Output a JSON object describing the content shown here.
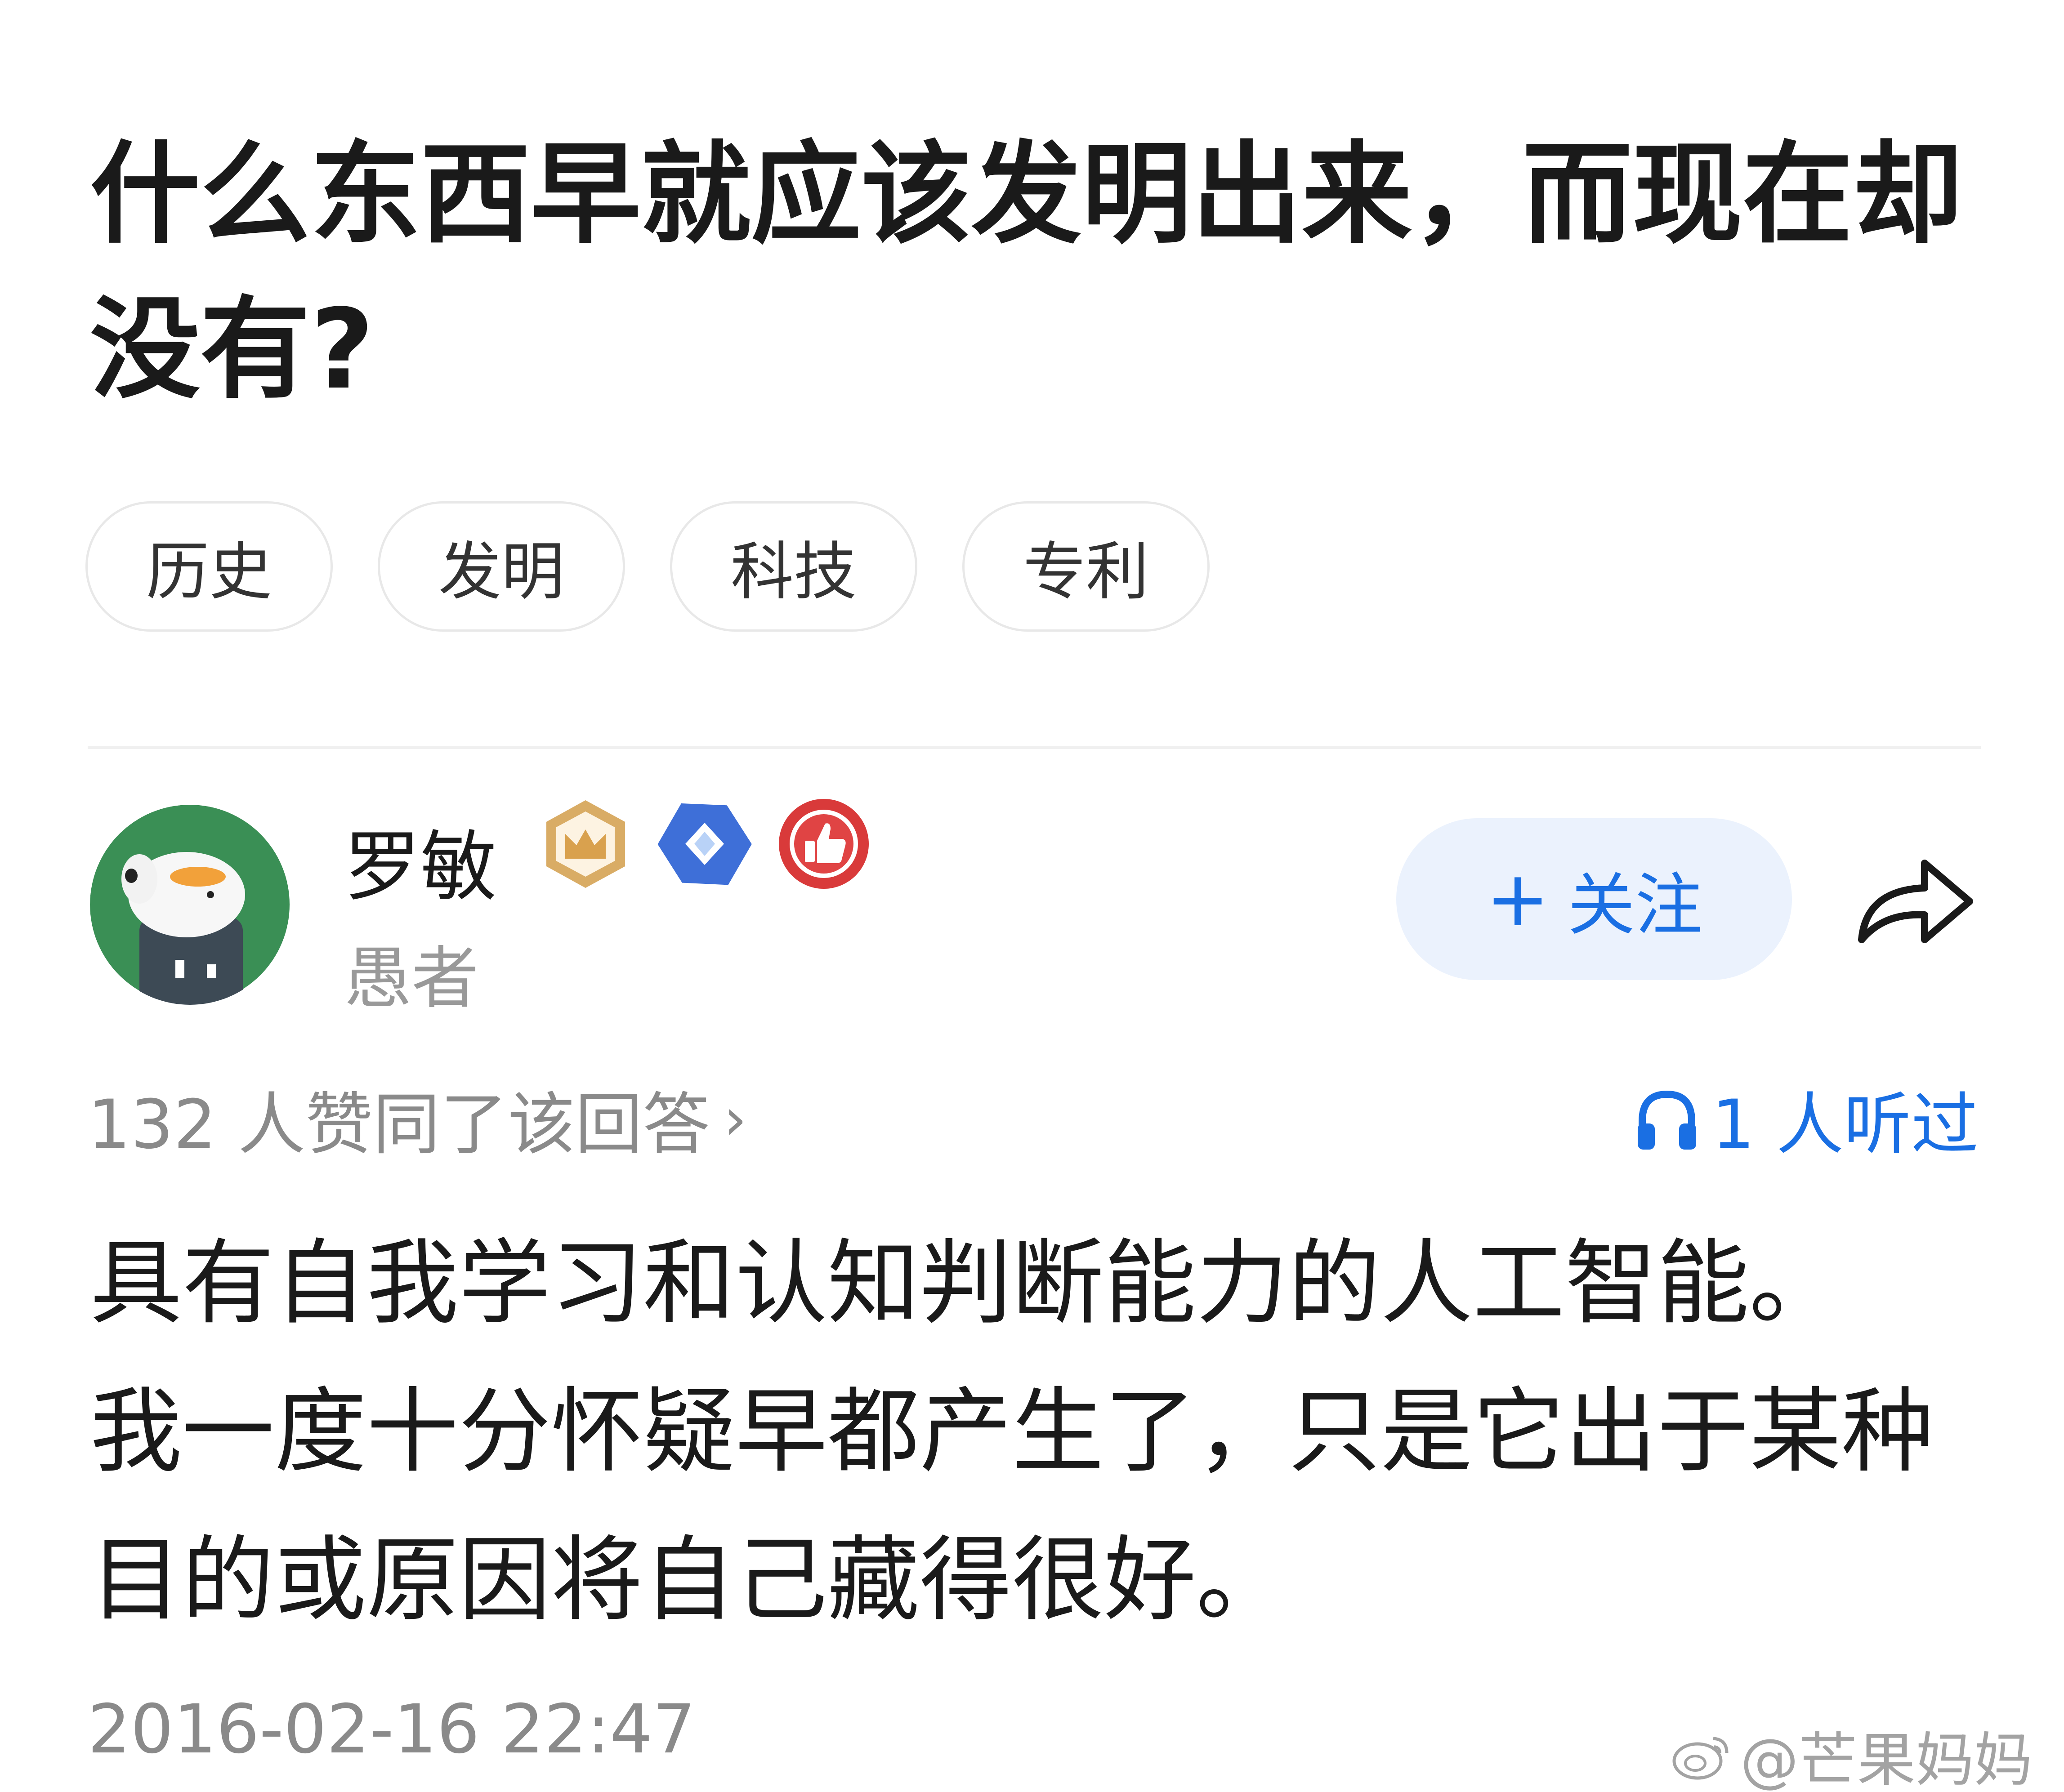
{
  "question": {
    "title_line1": "什么东西早就应该发明出来，而现在却",
    "title_line2": "没有?"
  },
  "tags": [
    "历史",
    "发明",
    "科技",
    "专利"
  ],
  "author": {
    "name": "罗敏",
    "subtitle": "愚者",
    "badges": [
      "crown-badge-icon",
      "diamond-badge-icon",
      "thumbs-up-badge-icon"
    ]
  },
  "follow_button": {
    "plus": "+",
    "label": "关注"
  },
  "stats": {
    "votes": "132 人赞同了该回答",
    "votes_arrow": "›",
    "listened": "1 人听过"
  },
  "answer": {
    "line1": "具有自我学习和认知判断能力的人工智能。",
    "line2": "我一度十分怀疑早都产生了，只是它出于某种",
    "line3": "目的或原因将自己藏得很好。"
  },
  "timestamp": "2016-02-16 22:47",
  "watermark": "@芒果妈妈",
  "colors": {
    "accent": "#1a6fe3",
    "follow_bg": "#ebf2fd",
    "muted_text": "#8a8a8a",
    "avatar_bg": "#3a8f55"
  }
}
